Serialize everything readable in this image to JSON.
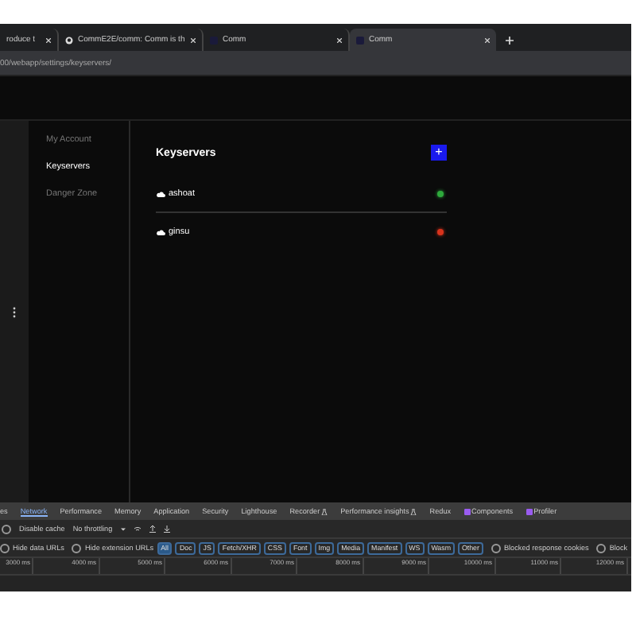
{
  "browser": {
    "tabs": [
      {
        "title": "roduce t",
        "kind": "page",
        "selected": false
      },
      {
        "title": "CommE2E/comm: Comm is th",
        "kind": "github",
        "selected": false
      },
      {
        "title": "Comm",
        "kind": "app",
        "selected": false
      },
      {
        "title": "Comm",
        "kind": "app",
        "selected": true
      }
    ],
    "url": "00/webapp/settings/keyservers/"
  },
  "sidebar": {
    "items": [
      {
        "label": "My Account",
        "selected": false
      },
      {
        "label": "Keyservers",
        "selected": true
      },
      {
        "label": "Danger Zone",
        "selected": false
      }
    ]
  },
  "keyservers": {
    "title": "Keyservers",
    "add_label": "+",
    "items": [
      {
        "name": "ashoat",
        "color": "#2eaa3c"
      },
      {
        "name": "ginsu",
        "color": "#d8331c"
      }
    ]
  },
  "devtools": {
    "tabs": [
      {
        "label": "es",
        "selected": false
      },
      {
        "label": "Network",
        "selected": true
      },
      {
        "label": "Performance",
        "selected": false
      },
      {
        "label": "Memory",
        "selected": false
      },
      {
        "label": "Application",
        "selected": false
      },
      {
        "label": "Security",
        "selected": false
      },
      {
        "label": "Lighthouse",
        "selected": false
      },
      {
        "label": "Recorder",
        "selected": false
      },
      {
        "label": "Performance insights",
        "selected": false
      },
      {
        "label": "Redux",
        "selected": false
      },
      {
        "label": "Components",
        "selected": false
      },
      {
        "label": "Profiler",
        "selected": false
      }
    ],
    "disable_cache": {
      "label": "Disable cache",
      "checked": false
    },
    "throttling": "No throttling",
    "hide_data_urls": {
      "label": "Hide data URLs",
      "checked": false
    },
    "hide_extension_urls": {
      "label": "Hide extension URLs",
      "checked": false
    },
    "filters": [
      {
        "label": "All",
        "selected": true
      },
      {
        "label": "Doc",
        "selected": false
      },
      {
        "label": "JS",
        "selected": false
      },
      {
        "label": "Fetch/XHR",
        "selected": false
      },
      {
        "label": "CSS",
        "selected": false
      },
      {
        "label": "Font",
        "selected": false
      },
      {
        "label": "Img",
        "selected": false
      },
      {
        "label": "Media",
        "selected": false
      },
      {
        "label": "Manifest",
        "selected": false
      },
      {
        "label": "WS",
        "selected": false
      },
      {
        "label": "Wasm",
        "selected": false
      },
      {
        "label": "Other",
        "selected": false
      }
    ],
    "blocked_cookies": {
      "label": "Blocked response cookies",
      "checked": false
    },
    "blocked_requests": {
      "label": "Block",
      "checked": false
    },
    "timeline": [
      "3000 ms",
      "4000 ms",
      "5000 ms",
      "6000 ms",
      "7000 ms",
      "8000 ms",
      "9000 ms",
      "10000 ms",
      "11000 ms",
      "12000 ms"
    ]
  }
}
